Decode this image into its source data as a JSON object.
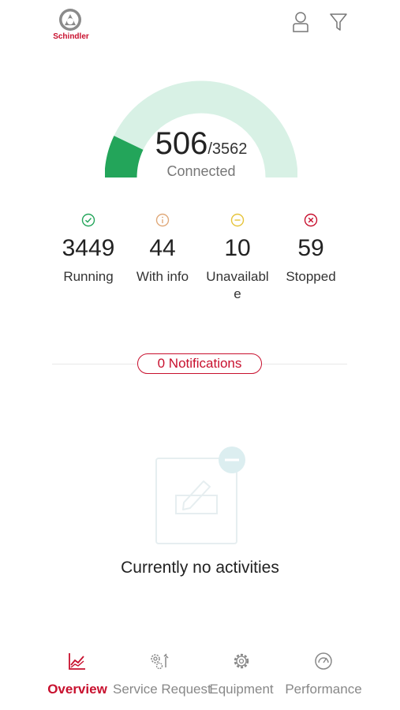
{
  "header": {
    "brand": "Schindler",
    "user_icon": "user-icon",
    "filter_icon": "filter-icon"
  },
  "gauge": {
    "connected": "506",
    "total": "/3562",
    "label": "Connected",
    "fraction": 0.142,
    "fill_color": "#23a55a",
    "track_color": "#d8f1e5"
  },
  "stats": [
    {
      "icon": "check-circle-icon",
      "value": "3449",
      "label": "Running",
      "color": "#23a55a"
    },
    {
      "icon": "info-circle-icon",
      "value": "44",
      "label": "With info",
      "color": "#e0a97a"
    },
    {
      "icon": "minus-circle-icon",
      "value": "10",
      "label": "Unavailable",
      "color": "#e6c43a"
    },
    {
      "icon": "x-circle-icon",
      "value": "59",
      "label": "Stopped",
      "color": "#c8102e"
    }
  ],
  "notifications": {
    "label": "0 Notifications"
  },
  "empty_state": {
    "icon": "edit-document-icon",
    "text": "Currently no activities"
  },
  "nav": {
    "items": [
      {
        "icon": "chart-icon",
        "label": "Overview",
        "active": true
      },
      {
        "icon": "gears-wrench-icon",
        "label": "Service Request",
        "active": false
      },
      {
        "icon": "gear-icon",
        "label": "Equipment",
        "active": false
      },
      {
        "icon": "gauge-icon",
        "label": "Performance",
        "active": false
      }
    ]
  },
  "colors": {
    "brand": "#c8102e",
    "accent_green": "#23a55a"
  }
}
